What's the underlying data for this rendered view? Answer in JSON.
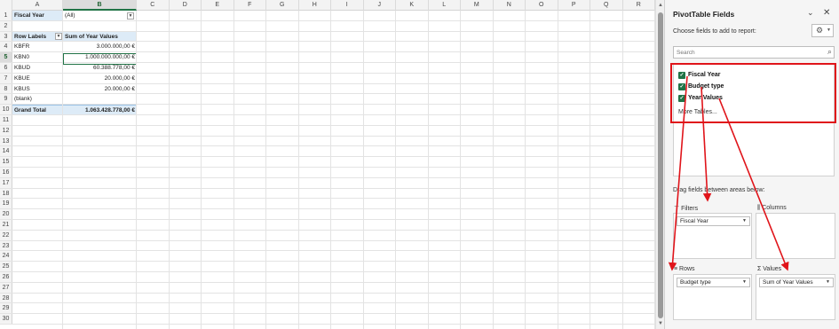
{
  "sheet": {
    "columns": [
      "A",
      "B",
      "C",
      "D",
      "E",
      "F",
      "G",
      "H",
      "I",
      "J",
      "K",
      "L",
      "M",
      "N",
      "O",
      "P",
      "Q",
      "R"
    ],
    "row_numbers": [
      "1",
      "2",
      "3",
      "4",
      "5",
      "6",
      "7",
      "8",
      "9",
      "10",
      "11",
      "12",
      "13",
      "14",
      "15",
      "16",
      "17",
      "18",
      "19",
      "20",
      "21",
      "22",
      "23",
      "24",
      "25",
      "26",
      "27",
      "28",
      "29",
      "30"
    ],
    "filter_label": "Fiscal Year",
    "filter_value": "(All)",
    "header_row_labels": "Row Labels",
    "header_sum": "Sum of Year Values",
    "rows": [
      {
        "label": "KBFR",
        "value": "3.000.000,00 €"
      },
      {
        "label": "KBN0",
        "value": "1.000.000.000,00 €"
      },
      {
        "label": "KBUD",
        "value": "60.388.778,00 €"
      },
      {
        "label": "KBUE",
        "value": "20.000,00 €"
      },
      {
        "label": "KBUS",
        "value": "20.000,00 €"
      },
      {
        "label": "(blank)",
        "value": ""
      }
    ],
    "grand_total_label": "Grand Total",
    "grand_total_value": "1.063.428.778,00 €"
  },
  "pane": {
    "title": "PivotTable Fields",
    "choose_label": "Choose fields to add to report:",
    "search_placeholder": "Search",
    "fields": [
      {
        "label": "Fiscal Year",
        "checked": true
      },
      {
        "label": "Budget type",
        "checked": true
      },
      {
        "label": "Year Values",
        "checked": true
      }
    ],
    "more_tables": "More Tables...",
    "drag_label": "Drag fields between areas below:",
    "areas": {
      "filters": {
        "label": "Filters",
        "chip": "Fiscal Year"
      },
      "columns": {
        "label": "Columns"
      },
      "rows": {
        "label": "Rows",
        "chip": "Budget type"
      },
      "values": {
        "label": "Values",
        "chip": "Sum of Year Values"
      }
    }
  },
  "colors": {
    "excel_green": "#217346",
    "highlight_red": "#e0141a",
    "pivot_header_band": "#ddebf7"
  }
}
